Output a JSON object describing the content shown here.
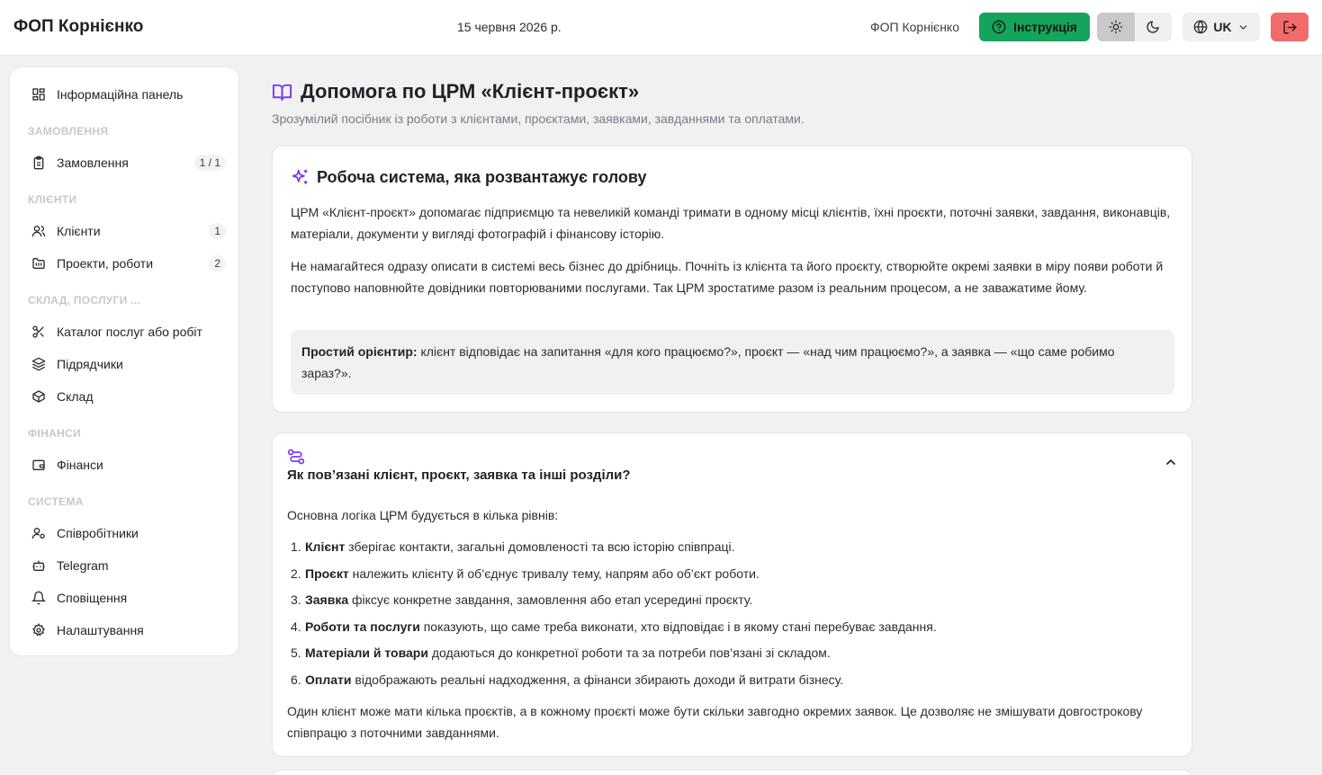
{
  "header": {
    "brand": "ФОП Корнієнко",
    "date": "15 червня 2026 р.",
    "user_name": "ФОП Корнієнко",
    "help_label": "Інструкція",
    "language": "UK"
  },
  "sidebar": {
    "dashboard": "Інформаційна панель",
    "sections": {
      "orders": "ЗАМОВЛЕННЯ",
      "clients": "КЛІЄНТИ",
      "warehouse": "СКЛАД, ПОСЛУГИ ...",
      "finance": "ФІНАНСИ",
      "system": "СИСТЕМА"
    },
    "items": {
      "orders": {
        "label": "Замовлення",
        "badge": "1 / 1"
      },
      "clients": {
        "label": "Клієнти",
        "badge": "1"
      },
      "projects": {
        "label": "Проекти, роботи",
        "badge": "2"
      },
      "catalog": {
        "label": "Каталог послуг або робіт"
      },
      "contractors": {
        "label": "Підрядчики"
      },
      "warehouse": {
        "label": "Склад"
      },
      "finance": {
        "label": "Фінанси"
      },
      "employees": {
        "label": "Співробітники"
      },
      "telegram": {
        "label": "Telegram"
      },
      "notifications": {
        "label": "Сповіщення"
      },
      "settings": {
        "label": "Налаштування"
      }
    }
  },
  "main": {
    "title": "Допомога по ЦРМ «Клієнт-проєкт»",
    "subtitle": "Зрозумілий посібник із роботи з клієнтами, проєктами, заявками, завданнями та оплатами.",
    "card1": {
      "title": "Робоча система, яка розвантажує голову",
      "p1": "ЦРМ «Клієнт-проєкт» допомагає підприємцю та невеликій команді тримати в одному місці клієнтів, їхні проєкти, поточні заявки, завдання, виконавців, матеріали, документи у вигляді фотографій і фінансову історію.",
      "p2": "Не намагайтеся одразу описати в системі весь бізнес до дрібниць. Почніть із клієнта та його проєкту, створюйте окремі заявки в міру появи роботи й поступово наповнюйте довідники повторюваними послугами. Так ЦРМ зростатиме разом із реальним процесом, а не заважатиме йому.",
      "tip_bold": "Простий орієнтир:",
      "tip_text": " клієнт відповідає на запитання «для кого працюємо?», проєкт — «над чим працюємо?», а заявка — «що саме робимо зараз?»."
    },
    "card2": {
      "title": "Як пов’язані клієнт, проєкт, заявка та інші розділи?",
      "intro": "Основна логіка ЦРМ будується в кілька рівнів:",
      "items": [
        {
          "num": "1.",
          "bold": "Клієнт",
          "text": " зберігає контакти, загальні домовленості та всю історію співпраці."
        },
        {
          "num": "2.",
          "bold": "Проєкт",
          "text": " належить клієнту й об’єднує тривалу тему, напрям або об’єкт роботи."
        },
        {
          "num": "3.",
          "bold": "Заявка",
          "text": " фіксує конкретне завдання, замовлення або етап усередині проєкту."
        },
        {
          "num": "4.",
          "bold": "Роботи та послуги",
          "text": " показують, що саме треба виконати, хто відповідає і в якому стані перебуває завдання."
        },
        {
          "num": "5.",
          "bold": "Матеріали й товари",
          "text": " додаються до конкретної роботи та за потреби пов’язані зі складом."
        },
        {
          "num": "6.",
          "bold": "Оплати",
          "text": " відображають реальні надходження, а фінанси збирають доходи й витрати бізнесу."
        }
      ],
      "outro": "Один клієнт може мати кілька проєктів, а в кожному проєкті може бути скільки завгодно окремих заявок. Це дозволяє не змішувати довгострокову співпрацю з поточними завданнями."
    }
  },
  "colors": {
    "accent_green": "#16a35b",
    "logout_red": "#f26b6b",
    "icon_purple": "#7c3aed"
  }
}
